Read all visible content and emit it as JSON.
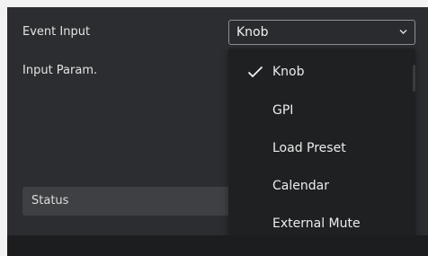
{
  "form": {
    "event_input_label": "Event Input",
    "input_param_label": "Input Param.",
    "status_label": "Status"
  },
  "select": {
    "value": "Knob",
    "chevron_icon": "chevron-down-icon"
  },
  "dropdown": {
    "items": [
      {
        "label": "Knob",
        "selected": true
      },
      {
        "label": "GPI",
        "selected": false
      },
      {
        "label": "Load Preset",
        "selected": false
      },
      {
        "label": "Calendar",
        "selected": false
      },
      {
        "label": "External Mute",
        "selected": false
      }
    ],
    "check_icon": "checkmark-icon"
  },
  "colors": {
    "panel_bg": "#2c2d30",
    "dropdown_bg": "#1f2022",
    "border": "#8d8f93",
    "text": "#e4e4e4"
  }
}
